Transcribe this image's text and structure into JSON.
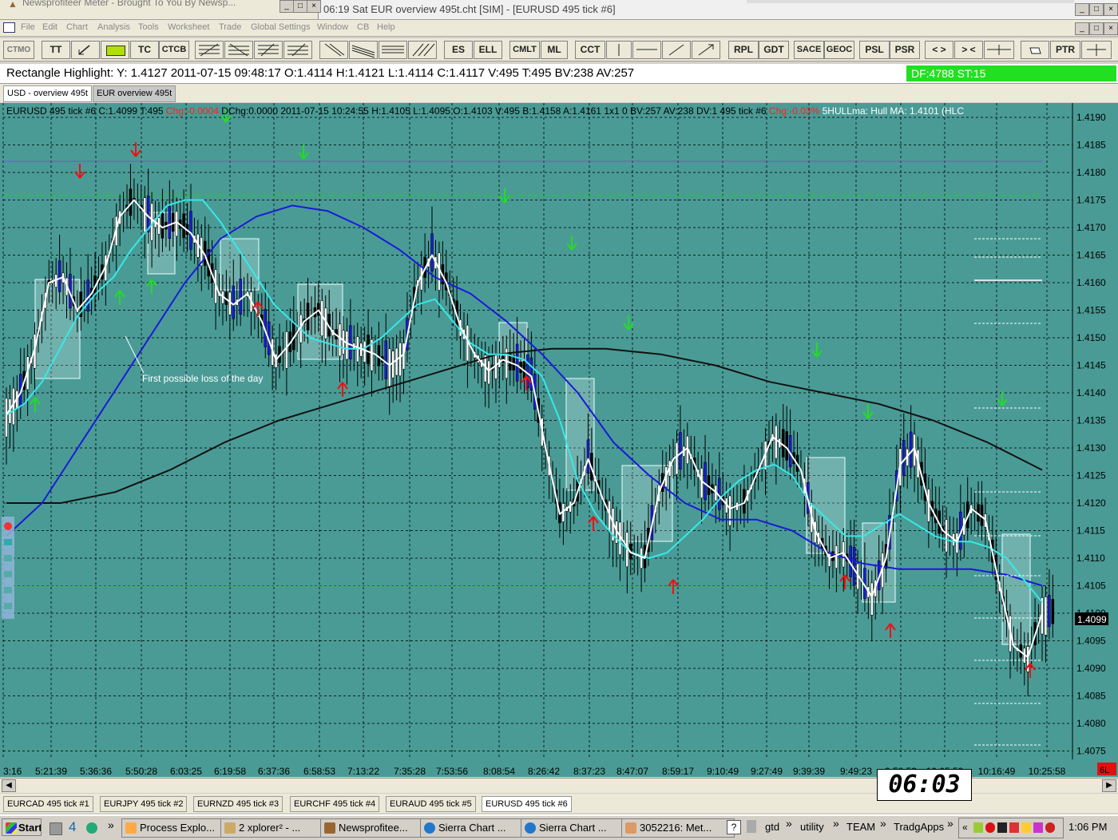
{
  "window": {
    "meter_title": "Newsprofiteer Meter - Brought To You By Newsp...",
    "title": "06:19  Sat   EUR overview 495t.cht [SIM] - [EURUSD  495 tick  #6]"
  },
  "menu": [
    "File",
    "Edit",
    "Chart",
    "Analysis",
    "Tools",
    "Worksheet",
    "Trade",
    "Global Settings",
    "Window",
    "CB",
    "Help"
  ],
  "toolbar": [
    "CTMO",
    "TT",
    "",
    "",
    "TC",
    "CTCB",
    "",
    "",
    "",
    "",
    "",
    "",
    "",
    "",
    "ES",
    "ELL",
    "CMLT",
    "ML",
    "CCT",
    "",
    "",
    "",
    "",
    "RPL",
    "GDT",
    "SACE",
    "GEOC",
    "PSL",
    "PSR",
    "< >",
    "> <",
    "",
    "",
    "PTR",
    ""
  ],
  "highlight": {
    "text": "Rectangle Highlight: Y: 1.4127  2011-07-15  09:48:17  O:1.4114  H:1.4121  L:1.4114  C:1.4117  V:495  T:495  BV:238  AV:257",
    "df": "DF:4788  ST:15"
  },
  "chart_tabs": [
    "USD - overview 495t",
    "EUR overview 495t"
  ],
  "chart_header": {
    "prefix": "EURUSD  495 tick  #6 C:1.4099 T:495 ",
    "chg": "Chg:-0.0004",
    "mid": " DChg:0.0000 2011-07-15 10:24:55 H:1.4105 L:1.4095 O:1.4103 V:495 B:1.4158 A:1.4161 1x1 0 BV:257 AV:238 DV:1 495 tick #6 ",
    "chgpct": "Chg:-0.03%",
    "suffix": "  5HULLma:  Hull MA: 1.4101   (HLC"
  },
  "annotation": "First possible loss of the day",
  "price_badge": "1.4099",
  "corner_badge": "6L",
  "clock_overlay": "06:03",
  "colors": {
    "background": "#4a9b96",
    "fast_ma": "#38e8e8",
    "mid_ma": "#1a1ad8",
    "slow_ma": "#111111",
    "hull": "#ffffff"
  },
  "chart_data": {
    "type": "candlestick",
    "symbol": "EURUSD 495 tick",
    "y_ticks": [
      "1.4190",
      "1.4185",
      "1.4180",
      "1.4175",
      "1.4170",
      "1.4165",
      "1.4160",
      "1.4155",
      "1.4150",
      "1.4145",
      "1.4140",
      "1.4135",
      "1.4130",
      "1.4125",
      "1.4120",
      "1.4115",
      "1.4110",
      "1.4105",
      "1.4100",
      "1.4095",
      "1.4090",
      "1.4085",
      "1.4080",
      "1.4075"
    ],
    "ylim": [
      1.4072,
      1.4193
    ],
    "x_ticks": [
      "3:16",
      "5:21:39",
      "5:36:36",
      "5:50:28",
      "6:03:25",
      "6:19:58",
      "6:37:36",
      "6:58:53",
      "7:13:22",
      "7:35:28",
      "7:53:56",
      "8:08:54",
      "8:26:42",
      "8:37:23",
      "8:47:07",
      "8:59:17",
      "9:10:49",
      "9:27:49",
      "9:39:39",
      "9:49:23",
      "9:58:53",
      "10:05:59",
      "10:16:49",
      "10:25:58"
    ],
    "hull_ma": [
      1.4136,
      1.414,
      1.4148,
      1.416,
      1.4161,
      1.4155,
      1.4158,
      1.4163,
      1.4172,
      1.4175,
      1.4172,
      1.417,
      1.4171,
      1.4169,
      1.4165,
      1.4158,
      1.4156,
      1.4158,
      1.4153,
      1.4146,
      1.4149,
      1.4153,
      1.4155,
      1.4151,
      1.4149,
      1.4148,
      1.4147,
      1.4145,
      1.4147,
      1.416,
      1.4165,
      1.416,
      1.4152,
      1.4147,
      1.4144,
      1.4146,
      1.4145,
      1.4143,
      1.413,
      1.4118,
      1.412,
      1.4128,
      1.4121,
      1.4115,
      1.4111,
      1.411,
      1.4122,
      1.4128,
      1.413,
      1.4124,
      1.4122,
      1.4119,
      1.412,
      1.4126,
      1.4132,
      1.413,
      1.4126,
      1.4115,
      1.411,
      1.4111,
      1.4107,
      1.4103,
      1.411,
      1.4127,
      1.413,
      1.412,
      1.4115,
      1.4113,
      1.4119,
      1.4117,
      1.4105,
      1.4094,
      1.4092,
      1.41
    ],
    "fast_ma": [
      1.4136,
      1.4138,
      1.4142,
      1.4148,
      1.4154,
      1.4158,
      1.4161,
      1.4166,
      1.417,
      1.4174,
      1.4175,
      1.4175,
      1.4171,
      1.4166,
      1.4161,
      1.4156,
      1.4153,
      1.415,
      1.4149,
      1.4148,
      1.4148,
      1.415,
      1.4153,
      1.4156,
      1.4157,
      1.4153,
      1.4149,
      1.4147,
      1.4147,
      1.4146,
      1.4143,
      1.4135,
      1.4124,
      1.4118,
      1.4114,
      1.4111,
      1.411,
      1.4111,
      1.4114,
      1.4117,
      1.4121,
      1.4124,
      1.4126,
      1.4127,
      1.4125,
      1.412,
      1.4117,
      1.4114,
      1.4114,
      1.4116,
      1.4118,
      1.4116,
      1.4114,
      1.4113,
      1.4113,
      1.4112,
      1.411,
      1.4106,
      1.4102
    ],
    "mid_ma": [
      1.4114,
      1.412,
      1.413,
      1.414,
      1.415,
      1.416,
      1.4168,
      1.4172,
      1.4174,
      1.4173,
      1.417,
      1.4166,
      1.4161,
      1.4158,
      1.4153,
      1.4147,
      1.414,
      1.4131,
      1.4125,
      1.412,
      1.4117,
      1.4117,
      1.4115,
      1.4111,
      1.4109,
      1.4108,
      1.4108,
      1.4108,
      1.4107,
      1.4105
    ],
    "slow_ma": [
      1.412,
      1.412,
      1.4122,
      1.4126,
      1.4131,
      1.4135,
      1.4138,
      1.4141,
      1.4144,
      1.4147,
      1.4148,
      1.4148,
      1.4147,
      1.4145,
      1.4142,
      1.414,
      1.4138,
      1.4135,
      1.4131,
      1.4126
    ]
  },
  "bottom_tabs": [
    "EURCAD  495 tick  #1",
    "EURJPY  495 tick  #2",
    "EURNZD  495 tick  #3",
    "EURCHF  495 tick  #4",
    "EURAUD  495 tick  #5",
    "EURUSD  495 tick  #6"
  ],
  "taskbar": {
    "start": "Start",
    "quick_num": "4",
    "tasks": [
      "Process Explo...",
      "2 xplorer² - ...",
      "Newsprofitee...",
      "Sierra Chart ...",
      "Sierra Chart ...",
      "3052216: Met..."
    ],
    "tray_links": [
      "gtd",
      "utility",
      "TEAM",
      "TradgApps"
    ],
    "time": "1:06 PM"
  }
}
